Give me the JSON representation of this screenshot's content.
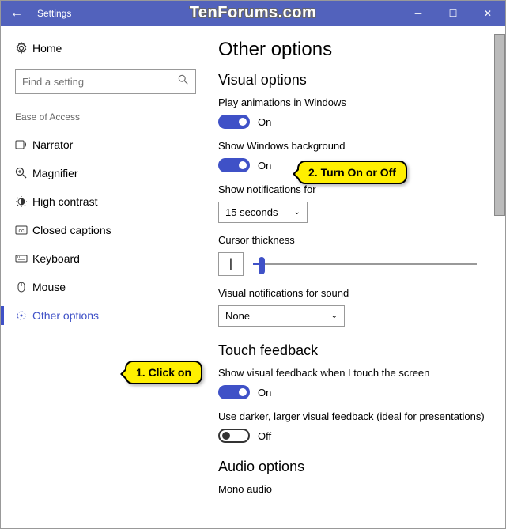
{
  "titlebar": {
    "title": "Settings"
  },
  "watermark": "TenForums.com",
  "sidebar": {
    "home_label": "Home",
    "search_placeholder": "Find a setting",
    "section_label": "Ease of Access",
    "items": [
      {
        "label": "Narrator"
      },
      {
        "label": "Magnifier"
      },
      {
        "label": "High contrast"
      },
      {
        "label": "Closed captions"
      },
      {
        "label": "Keyboard"
      },
      {
        "label": "Mouse"
      },
      {
        "label": "Other options"
      }
    ]
  },
  "main": {
    "title": "Other options",
    "visual_heading": "Visual options",
    "play_anim": {
      "label": "Play animations in Windows",
      "state": "On"
    },
    "show_bg": {
      "label": "Show Windows background",
      "state": "On"
    },
    "notif": {
      "label": "Show notifications for",
      "value": "15 seconds"
    },
    "cursor": {
      "label": "Cursor thickness"
    },
    "vis_notif": {
      "label": "Visual notifications for sound",
      "value": "None"
    },
    "touch_heading": "Touch feedback",
    "touch_visual": {
      "label": "Show visual feedback when I touch the screen",
      "state": "On"
    },
    "touch_darker": {
      "label": "Use darker, larger visual feedback (ideal for presentations)",
      "state": "Off"
    },
    "audio_heading": "Audio options",
    "mono": {
      "label": "Mono audio"
    }
  },
  "callouts": {
    "c1": "1. Click on",
    "c2": "2. Turn On or Off"
  }
}
